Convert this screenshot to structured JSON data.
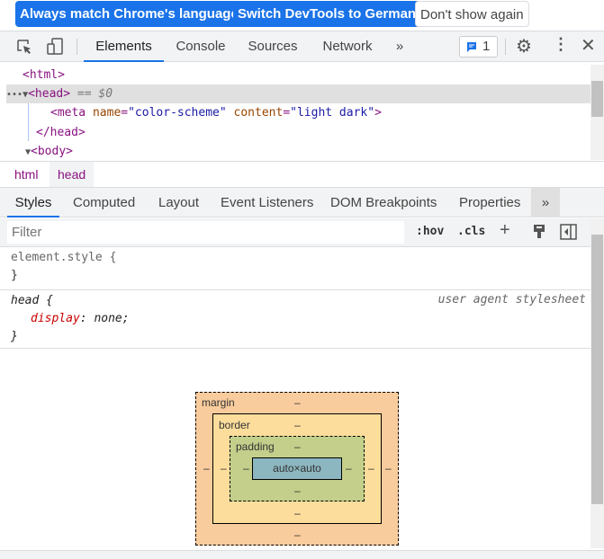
{
  "lang_bar": {
    "always_match": "Always match Chrome's language",
    "switch": "Switch DevTools to German",
    "dont_show": "Don't show again"
  },
  "toolbar": {
    "tabs": [
      "Elements",
      "Console",
      "Sources",
      "Network"
    ],
    "more": "»",
    "issues_count": "1"
  },
  "dom": {
    "html": "<html>",
    "head_open": "<head>",
    "head_marker": "== $0",
    "meta_tag": "<meta ",
    "meta_attr1": "name",
    "meta_val1": "\"color-scheme\"",
    "meta_attr2": "content",
    "meta_val2": "\"light dark\"",
    "meta_close": ">",
    "head_close": "</head>",
    "body": "<body>",
    "dots": "•••"
  },
  "breadcrumbs": [
    "html",
    "head"
  ],
  "subtabs": [
    "Styles",
    "Computed",
    "Layout",
    "Event Listeners",
    "DOM Breakpoints",
    "Properties"
  ],
  "subtabs_more": "»",
  "filter": {
    "placeholder": "Filter",
    "hov": ":hov",
    "cls": ".cls",
    "plus": "+"
  },
  "styles": {
    "element_selector": "element.style {",
    "close": "}",
    "head_selector": "head {",
    "source": "user agent stylesheet",
    "prop": "display",
    "value": "none;"
  },
  "box_model": {
    "margin": "margin",
    "border": "border",
    "padding": "padding",
    "content": "auto×auto",
    "dash": "–"
  }
}
